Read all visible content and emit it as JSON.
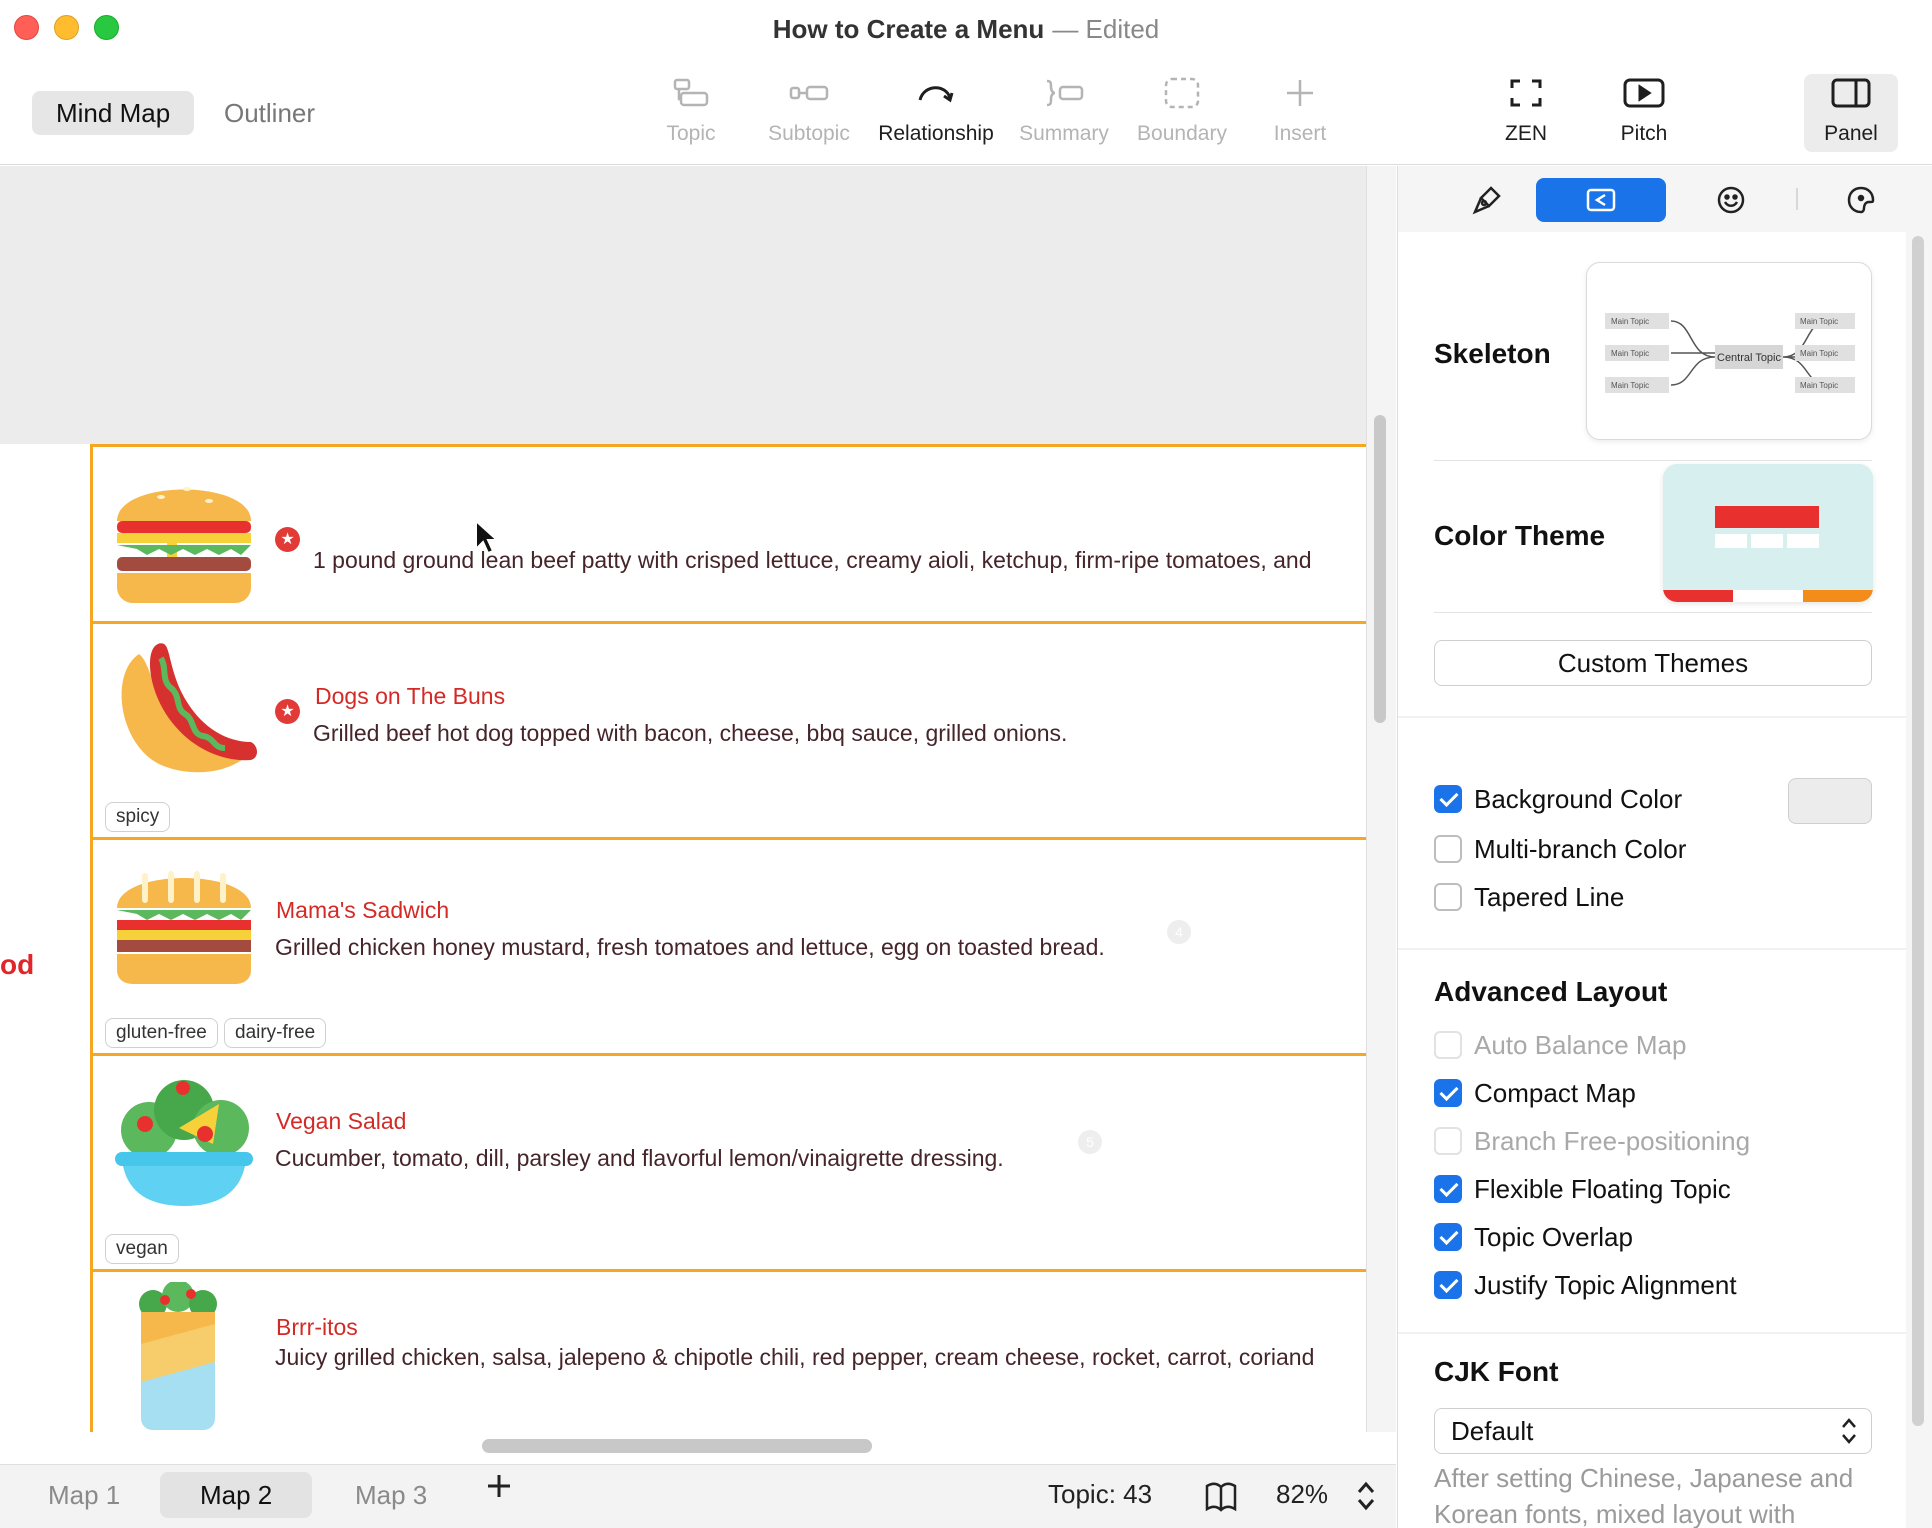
{
  "window": {
    "title": "How to Create a Menu",
    "status": "— Edited"
  },
  "view_switch": {
    "mind_map": "Mind Map",
    "outliner": "Outliner"
  },
  "toolbar": {
    "topic": "Topic",
    "subtopic": "Subtopic",
    "relationship": "Relationship",
    "summary": "Summary",
    "boundary": "Boundary",
    "insert": "Insert",
    "zen": "ZEN",
    "pitch": "Pitch",
    "panel": "Panel"
  },
  "canvas": {
    "side_label": "od",
    "items": [
      {
        "title": "",
        "description": "1 pound ground lean beef patty with crisped lettuce, creamy aioli, ketchup, firm-ripe tomatoes, and",
        "tags": [],
        "icon": "burger-icon"
      },
      {
        "title": "Dogs on The Buns",
        "description": "Grilled beef hot dog topped with bacon, cheese, bbq sauce, grilled onions.",
        "tags": [
          "spicy"
        ],
        "icon": "hotdog-icon"
      },
      {
        "title": "Mama's Sadwich",
        "description": "Grilled chicken honey mustard, fresh tomatoes and lettuce, egg on toasted bread.",
        "tags": [
          "gluten-free",
          "dairy-free"
        ],
        "number": "4",
        "icon": "sandwich-icon"
      },
      {
        "title": "Vegan Salad",
        "description": "Cucumber, tomato, dill, parsley and flavorful lemon/vinaigrette dressing.",
        "tags": [
          "vegan"
        ],
        "number": "5",
        "icon": "salad-icon"
      },
      {
        "title": "Brrr-itos",
        "description": "Juicy grilled chicken, salsa, jalepeno & chipotle chili, red pepper, cream cheese, rocket, carrot, coriand",
        "tags": [],
        "icon": "burrito-icon"
      }
    ]
  },
  "bottom_bar": {
    "sheets": [
      "Map 1",
      "Map 2",
      "Map 3"
    ],
    "active_sheet": "Map 2",
    "topic_count": "Topic: 43",
    "zoom": "82%"
  },
  "panel": {
    "skeleton": {
      "label": "Skeleton",
      "preview": {
        "center": "Central Topic",
        "node": "Main Topic"
      }
    },
    "color_theme": {
      "label": "Color Theme"
    },
    "custom_themes": "Custom Themes",
    "options": [
      {
        "label": "Background Color",
        "checked": true,
        "disabled": false
      },
      {
        "label": "Multi-branch Color",
        "checked": false,
        "disabled": false
      },
      {
        "label": "Tapered Line",
        "checked": false,
        "disabled": false
      }
    ],
    "advanced_layout": {
      "heading": "Advanced Layout",
      "options": [
        {
          "label": "Auto Balance Map",
          "checked": false,
          "disabled": true
        },
        {
          "label": "Compact Map",
          "checked": true,
          "disabled": false
        },
        {
          "label": "Branch Free-positioning",
          "checked": false,
          "disabled": true
        },
        {
          "label": "Flexible Floating Topic",
          "checked": true,
          "disabled": false
        },
        {
          "label": "Topic Overlap",
          "checked": true,
          "disabled": false
        },
        {
          "label": "Justify Topic Alignment",
          "checked": true,
          "disabled": false
        }
      ]
    },
    "cjk_font": {
      "heading": "CJK Font",
      "value": "Default",
      "note": "After setting Chinese, Japanese and Korean fonts, mixed layout with"
    }
  },
  "colors": {
    "accent": "#1a73e8",
    "branch": "#f5a623",
    "title_red": "#d42a26"
  }
}
